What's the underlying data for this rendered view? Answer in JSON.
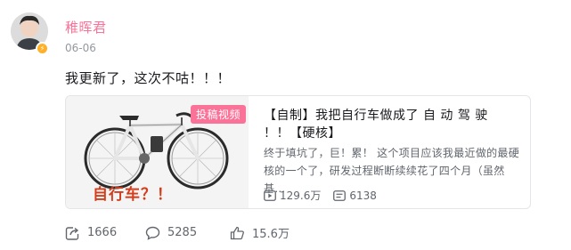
{
  "author": {
    "name": "稚晖君",
    "date": "06-06",
    "badge_icon": "lightning-icon"
  },
  "post": {
    "text": "我更新了，这次不咕！！！"
  },
  "video_card": {
    "tag": "投稿视频",
    "thumbnail_caption": "自行车？！",
    "title": "【自制】我把自行车做成了 自 动 驾 驶 ！！【硬核】",
    "description": "终于填坑了，巨！累！ 这个项目应该我最近做的最硬核的一个了，研发过程断断续续花了四个月（虽然基…",
    "plays": "129.6万",
    "danmaku": "6138"
  },
  "actions": {
    "forward_count": "1666",
    "comment_count": "5285",
    "like_count": "15.6万"
  },
  "colors": {
    "accent_pink": "#fb7299",
    "text_gray": "#61666d",
    "caption_red": "#d43d1c"
  }
}
